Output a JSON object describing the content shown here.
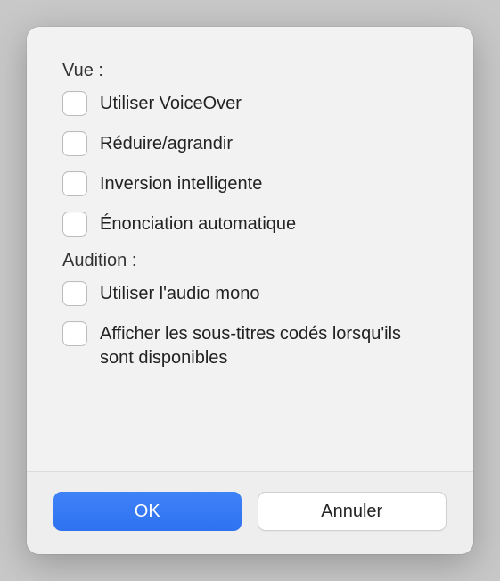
{
  "sections": {
    "vue": {
      "label": "Vue :",
      "options": [
        {
          "label": "Utiliser VoiceOver",
          "checked": false
        },
        {
          "label": "Réduire/agrandir",
          "checked": false
        },
        {
          "label": "Inversion intelligente",
          "checked": false
        },
        {
          "label": "Énonciation automatique",
          "checked": false
        }
      ]
    },
    "audition": {
      "label": "Audition :",
      "options": [
        {
          "label": "Utiliser l'audio mono",
          "checked": false
        },
        {
          "label": "Afficher les sous-titres codés lorsqu'ils sont disponibles",
          "checked": false
        }
      ]
    }
  },
  "buttons": {
    "ok": "OK",
    "cancel": "Annuler"
  }
}
